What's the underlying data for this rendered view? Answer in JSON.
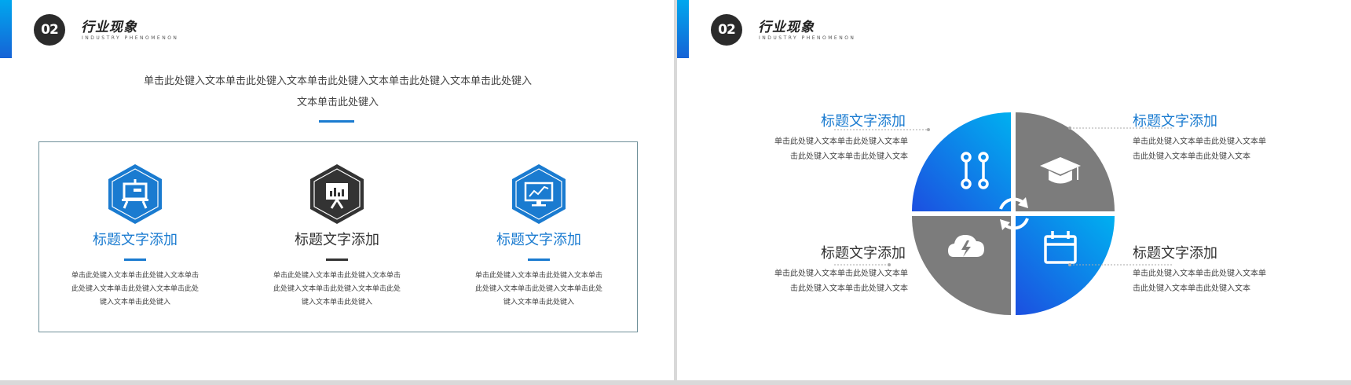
{
  "left_slide": {
    "section_number": "02",
    "section_title": "行业现象",
    "section_subtitle": "INDUSTRY PHENOMENON",
    "intro_text": "单击此处键入文本单击此处键入文本单击此处键入文本单击此处键入文本单击此处键入文本单击此处键入",
    "cards": [
      {
        "icon": "presentation-easel-icon",
        "title": "标题文字添加",
        "text": "单击此处键入文本单击此处键入文本单击此处键入文本单击此处键入文本单击此处键入文本单击此处键入"
      },
      {
        "icon": "presentation-board-chart-icon",
        "title": "标题文字添加",
        "text": "单击此处键入文本单击此处键入文本单击此处键入文本单击此处键入文本单击此处键入文本单击此处键入"
      },
      {
        "icon": "monitor-trend-chart-icon",
        "title": "标题文字添加",
        "text": "单击此处键入文本单击此处键入文本单击此处键入文本单击此处键入文本单击此处键入文本单击此处键入"
      }
    ]
  },
  "right_slide": {
    "section_number": "02",
    "section_title": "行业现象",
    "section_subtitle": "INDUSTRY PHENOMENON",
    "items": [
      {
        "icon": "circuit-connection-icon",
        "title": "标题文字添加",
        "text": "单击此处键入文本单击此处键入文本单击此处键入文本单击此处键入文本"
      },
      {
        "icon": "graduation-cap-icon",
        "title": "标题文字添加",
        "text": "单击此处键入文本单击此处键入文本单击此处键入文本单击此处键入文本"
      },
      {
        "icon": "cloud-lightning-icon",
        "title": "标题文字添加",
        "text": "单击此处键入文本单击此处键入文本单击此处键入文本单击此处键入文本"
      },
      {
        "icon": "calendar-icon",
        "title": "标题文字添加",
        "text": "单击此处键入文本单击此处键入文本单击此处键入文本单击此处键入文本"
      }
    ],
    "center_icon": "refresh-cycle-icon"
  },
  "colors": {
    "accent_blue": "#1a7bd0",
    "gradient_light": "#00aef0",
    "gradient_dark": "#1c4fe0",
    "gray": "#7c7c7c",
    "dark": "#2b2b2b"
  }
}
